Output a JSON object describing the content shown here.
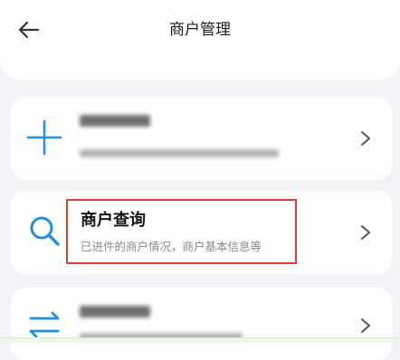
{
  "header": {
    "title": "商户管理",
    "back_icon": "arrow-left-icon"
  },
  "cards": [
    {
      "icon": "plus-icon",
      "title": "",
      "subtitle": ""
    },
    {
      "icon": "search-icon",
      "title": "商户查询",
      "subtitle": "已进件的商户情况，商户基本信息等"
    },
    {
      "icon": "swap-arrows-icon",
      "title": "",
      "subtitle": ""
    }
  ],
  "colors": {
    "accent": "#1f8fe0",
    "highlight": "#e53935",
    "background": "#f3f4f8"
  }
}
